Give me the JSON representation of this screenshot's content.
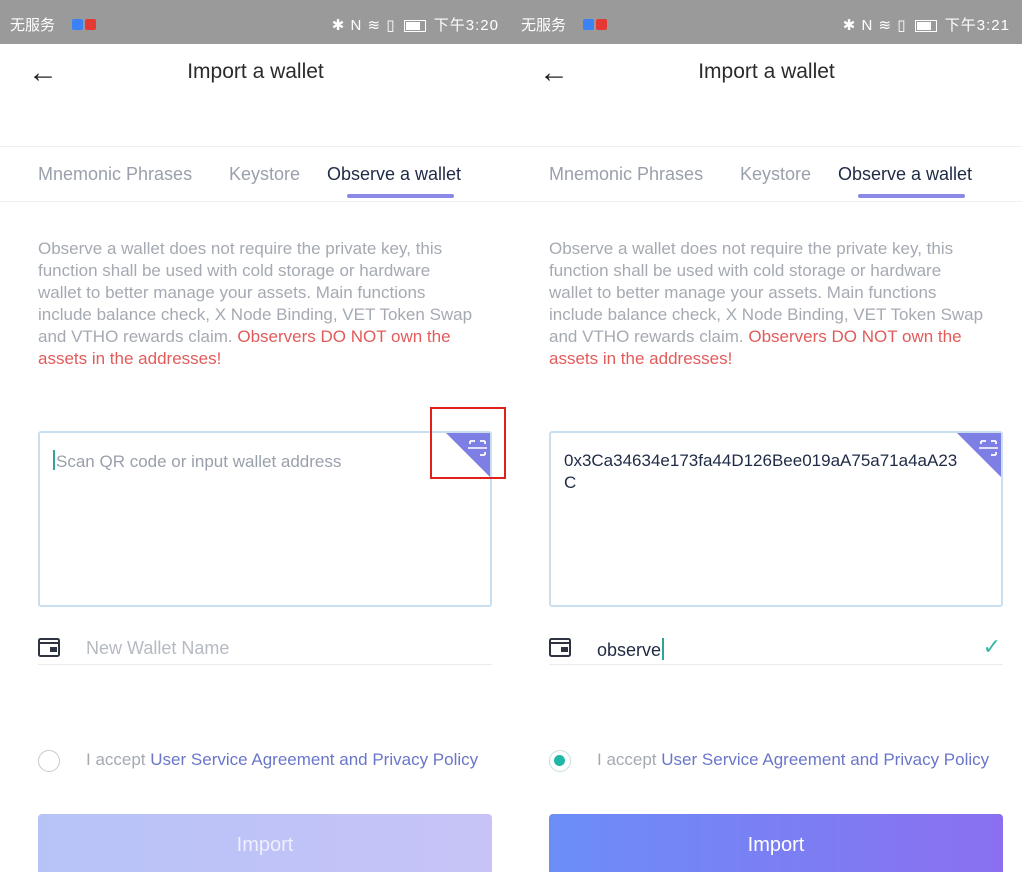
{
  "colors": {
    "accent_teal": "#21b7a8",
    "warning_red": "#e25b5b",
    "tab_underline": "#8b88e8",
    "button_gradient_start": "#6b8ef6",
    "button_gradient_end": "#8a70f0",
    "highlight_red": "#e0201b"
  },
  "screens": [
    {
      "status_bar": {
        "carrier": "无服务",
        "system_icons": "✱ N ≋ ▯",
        "time": "下午3:20"
      },
      "header": {
        "title": "Import a wallet"
      },
      "tabs": [
        {
          "label": "Mnemonic Phrases",
          "active": false
        },
        {
          "label": "Keystore",
          "active": false
        },
        {
          "label": "Observe a wallet",
          "active": true
        }
      ],
      "description": "Observe a wallet does not require the private key, this function shall be used with cold storage or hardware wallet to better manage your assets. Main functions include balance check, X Node Binding, VET Token Swap and VTHO rewards claim.",
      "warning": "Observers DO NOT own the assets in the addresses!",
      "address_input": {
        "value": "",
        "placeholder": "Scan QR code or input wallet address"
      },
      "wallet_name_input": {
        "value": "",
        "placeholder": "New Wallet Name"
      },
      "agreement": {
        "checked": false,
        "prefix": "I accept",
        "link": "User Service Agreement and Privacy Policy"
      },
      "import_button": {
        "label": "Import",
        "enabled": false
      }
    },
    {
      "status_bar": {
        "carrier": "无服务",
        "system_icons": "✱ N ≋ ▯",
        "time": "下午3:21"
      },
      "header": {
        "title": "Import a wallet"
      },
      "tabs": [
        {
          "label": "Mnemonic Phrases",
          "active": false
        },
        {
          "label": "Keystore",
          "active": false
        },
        {
          "label": "Observe a wallet",
          "active": true
        }
      ],
      "description": "Observe a wallet does not require the private key, this function shall be used with cold storage or hardware wallet to better manage your assets. Main functions include balance check, X Node Binding, VET Token Swap and VTHO rewards claim.",
      "warning": "Observers DO NOT own the assets in the addresses!",
      "address_input": {
        "value": "0x3Ca34634e173fa44D126Bee019aA75a71a4aA23C",
        "placeholder": "Scan QR code or input wallet address"
      },
      "wallet_name_input": {
        "value": "observe",
        "placeholder": "New Wallet Name",
        "valid": true
      },
      "agreement": {
        "checked": true,
        "prefix": "I accept",
        "link": "User Service Agreement and Privacy Policy"
      },
      "import_button": {
        "label": "Import",
        "enabled": true
      }
    }
  ]
}
